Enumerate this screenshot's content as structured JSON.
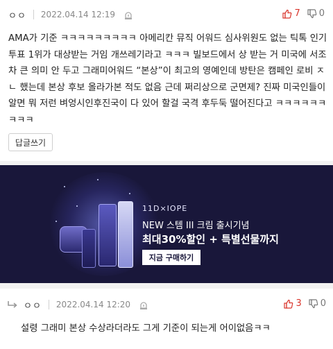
{
  "comment1": {
    "author": "ㅇㅇ",
    "date": "2022.04.14 12:19",
    "upvotes": "7",
    "downvotes": "0",
    "text": "AMA가 기준 ㅋㅋㅋㅋㅋㅋㅋㅋㅋ 아메리칸 뮤직 어워드 심사위원도 없는 틱톡 인기투표 1위가 대상받는 거임 개쓰레기라고 ㅋㅋㅋ 빌보드에서 상 받는 거 미국에 서조차 큰 의미 안 두고 그래미어워드 “본상”이 최고의 영예인데 방탄은 캠페인 로비 ㅈㄴ 했는데 본상 후보 올라가본 적도 없음 근데 쩌리상으로 군면제? 진짜 미국인들이 알면 뭐 저런 벼엉시인후진국이 다 있어 할걸 국격 후두둑 떨어진다고 ㅋㅋㅋㅋㅋㅋㅋㅋㅋ",
    "reply_button": "답글쓰기"
  },
  "ad": {
    "brand": "11D×IOPE",
    "line1": "NEW 스템 III 크림 출시기념",
    "line2": "최대30%할인 + 특별선물까지",
    "cta": "지금 구매하기"
  },
  "comment2": {
    "author": "ㅇㅇ",
    "date": "2022.04.14 12:20",
    "upvotes": "3",
    "downvotes": "0",
    "text": "설령 그래미 본상 수상라더라도 그게 기준이 되는게 어이없음ㅋㅋ"
  },
  "icons": {
    "report": "siren-icon",
    "upvote": "thumbs-up-icon",
    "downvote": "thumbs-down-icon",
    "reply": "reply-arrow-icon"
  },
  "colors": {
    "upvote": "#d9342b",
    "ad_background": "#19173a"
  }
}
